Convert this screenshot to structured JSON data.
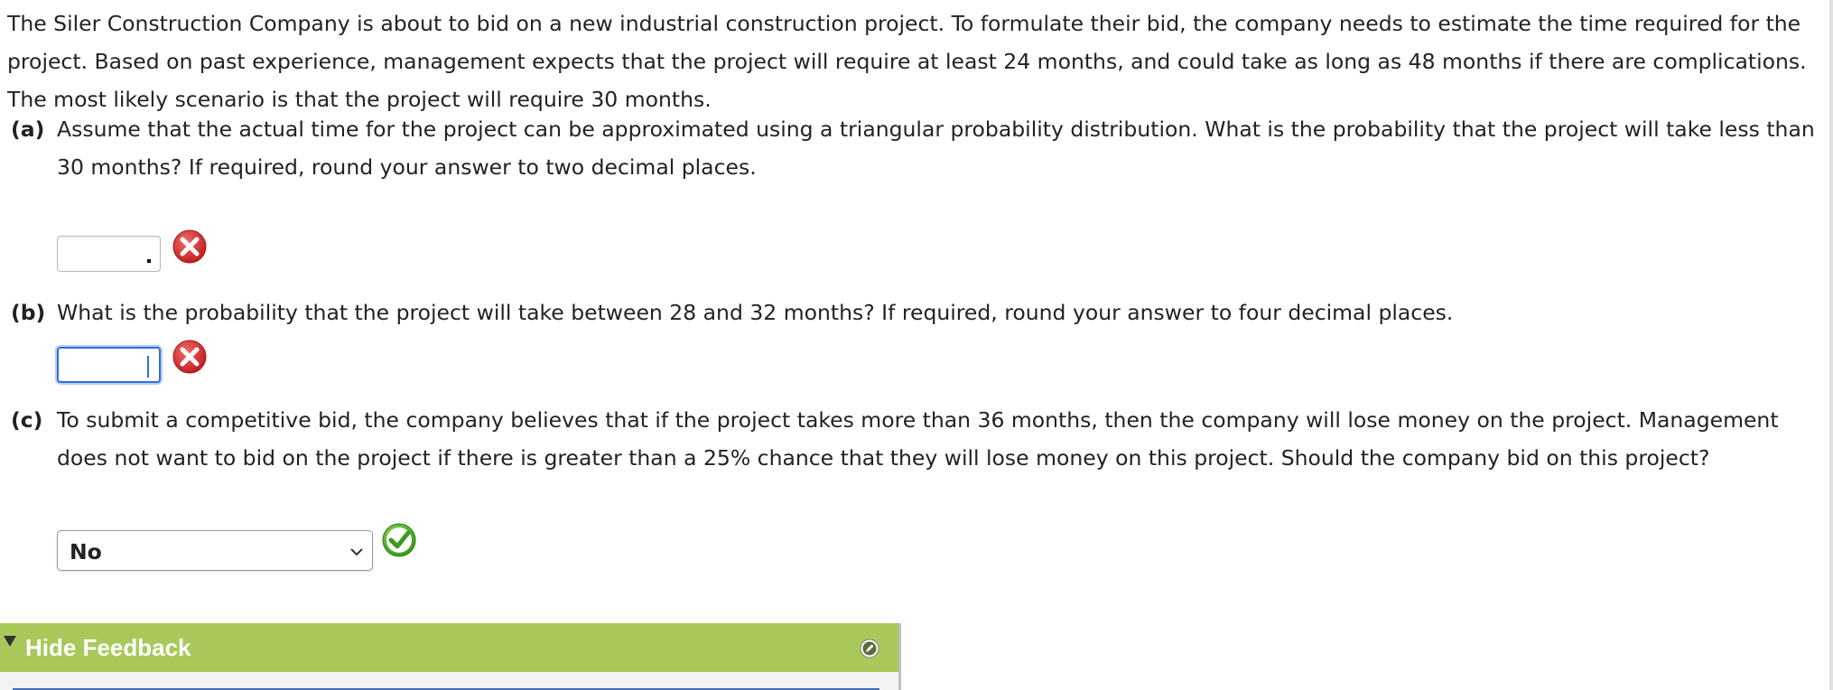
{
  "problem": {
    "intro": "The Siler Construction Company is about to bid on a new industrial construction project. To formulate their bid, the company needs to estimate the time required for the project. Based on past experience, management expects that the project will require at least 24 months, and could take as long as 48 months if there are complications. The most likely scenario is that the project will require 30 months."
  },
  "questions": [
    {
      "label": "(a)",
      "text": "Assume that the actual time for the project can be approximated using a triangular probability distribution. What is the probability that the project will take less than 30 months? If required, round your answer to two decimal places.",
      "answer_value": "",
      "status": "incorrect",
      "status_icon": "red-x-icon"
    },
    {
      "label": "(b)",
      "text": "What is the probability that the project will take between 28 and 32 months? If required, round your answer to four decimal places.",
      "answer_value": "",
      "status": "incorrect",
      "status_icon": "red-x-icon"
    },
    {
      "label": "(c)",
      "text": "To submit a competitive bid, the company believes that if the project takes more than 36 months, then the company will lose money on the project. Management does not want to bid on the project if there is greater than a 25% chance that they will lose money on this project. Should the company bid on this project?",
      "selected_option": "No",
      "status": "correct",
      "status_icon": "green-check-icon"
    }
  ],
  "feedback": {
    "toggle_label": "Hide Feedback",
    "bar_color": "#a8c95a"
  },
  "colors": {
    "incorrect": "#d9302f",
    "correct": "#4caf2a",
    "focus": "#2f6fde"
  }
}
